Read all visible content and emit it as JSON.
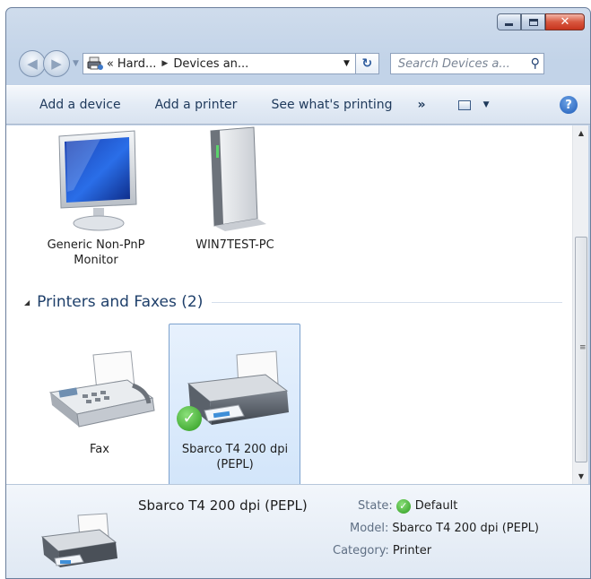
{
  "window": {
    "caption_buttons": {
      "minimize": "",
      "maximize": "",
      "close": "✕"
    }
  },
  "address": {
    "overflow": "«",
    "crumb1": "Hard...",
    "crumb2": "Devices an...",
    "search_placeholder": "Search Devices a..."
  },
  "toolbar": {
    "add_device": "Add a device",
    "add_printer": "Add a printer",
    "see_printing": "See what's printing",
    "more": "»"
  },
  "devices": [
    {
      "label": "Generic Non-PnP Monitor",
      "line1": "Generic Non-PnP",
      "line2": "Monitor",
      "icon": "monitor-icon"
    },
    {
      "label": "WIN7TEST-PC",
      "icon": "computer-tower-icon"
    }
  ],
  "printers_group": {
    "title": "Printers and Faxes (2)",
    "items": [
      {
        "label": "Fax",
        "icon": "fax-icon"
      },
      {
        "line1": "Sbarco T4 200 dpi",
        "line2": "(PEPL)",
        "icon": "printer-icon",
        "selected": true,
        "default": true
      }
    ]
  },
  "details": {
    "name": "Sbarco T4 200 dpi (PEPL)",
    "state_key": "State:",
    "state_value": "Default",
    "model_key": "Model:",
    "model_value": "Sbarco T4 200 dpi (PEPL)",
    "category_key": "Category:",
    "category_value": "Printer"
  },
  "colors": {
    "accent": "#1e395b",
    "selection": "#d2e5fa",
    "default_check": "#2c9a1e"
  }
}
